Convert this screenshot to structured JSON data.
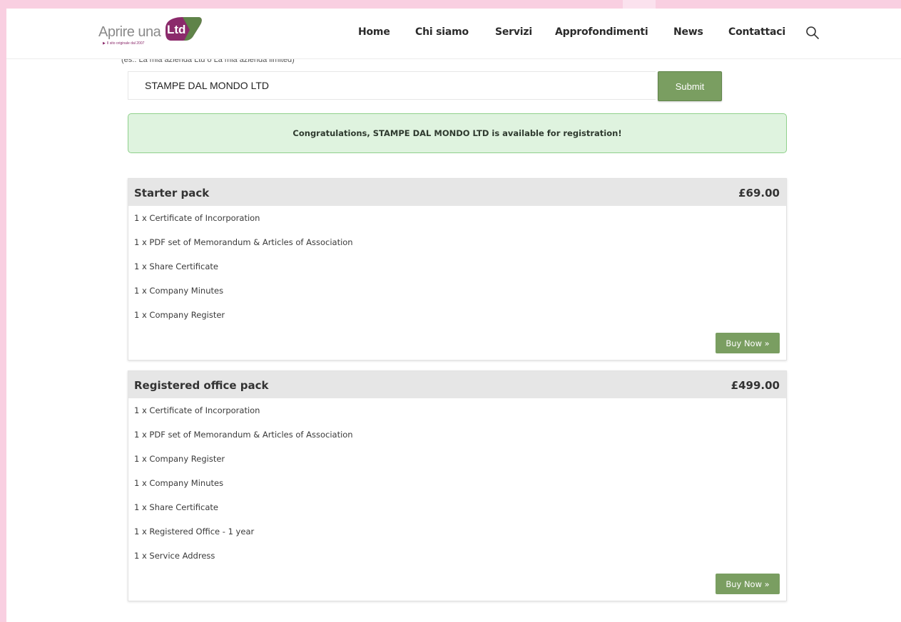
{
  "header": {
    "logo": {
      "text": "Aprire una",
      "badge": "Ltd",
      "tagline": "Il sito originale dal 2007"
    },
    "nav": [
      {
        "label": "Home"
      },
      {
        "label": "Chi siamo"
      },
      {
        "label": "Servizi"
      },
      {
        "label": "Approfondimenti"
      },
      {
        "label": "News"
      },
      {
        "label": "Contattaci"
      }
    ],
    "search_icon": "search-icon"
  },
  "search": {
    "helper_text": "(es.: La mia azienda Ltd o La mia azienda limited)",
    "value": "STAMPE DAL MONDO LTD",
    "submit_label": "Submit"
  },
  "alert": {
    "message": "Congratulations, STAMPE DAL MONDO LTD is available for registration!"
  },
  "packs": [
    {
      "title": "Starter pack",
      "price": "£69.00",
      "items": [
        "1 x Certificate of Incorporation",
        "1 x PDF set of Memorandum & Articles of Association",
        "1 x Share Certificate",
        "1 x Company Minutes",
        "1 x Company Register"
      ],
      "buy_label": "Buy Now »"
    },
    {
      "title": "Registered office pack",
      "price": "£499.00",
      "items": [
        "1 x Certificate of Incorporation",
        "1 x PDF set of Memorandum & Articles of Association",
        "1 x Company Register",
        "1 x Company Minutes",
        "1 x Share Certificate",
        "1 x Registered Office - 1 year",
        "1 x Service Address"
      ],
      "buy_label": "Buy Now »"
    }
  ],
  "colors": {
    "background": "#f9cfe1",
    "brand": "#8b2a6b",
    "button_green": "#7a9e61",
    "alert_bg": "#dff3df",
    "alert_border": "#8fd08b"
  }
}
